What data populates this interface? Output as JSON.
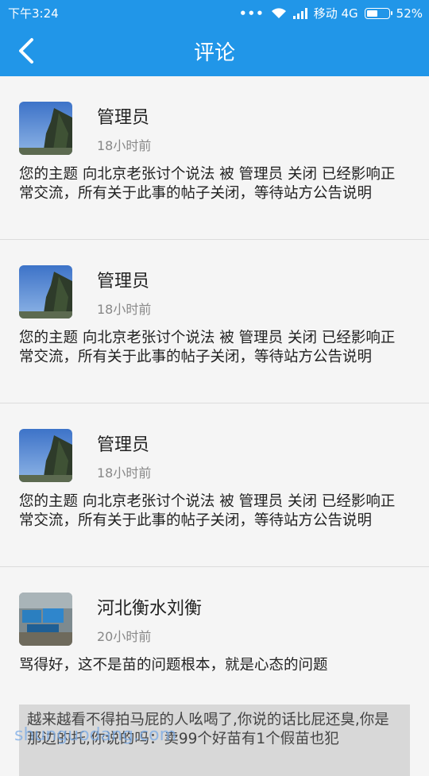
{
  "status": {
    "time": "下午3:24",
    "dots": "•••",
    "carrier": "移动 4G",
    "battery_percent": 52,
    "battery_text": "52%"
  },
  "header": {
    "title": "评论"
  },
  "comments": [
    {
      "name": "管理员",
      "time": "18小时前",
      "content": "您的主题 向北京老张讨个说法 被 管理员 关闭 已经影响正常交流，所有关于此事的帖子关闭，等待站方公告说明"
    },
    {
      "name": "管理员",
      "time": "18小时前",
      "content": "您的主题 向北京老张讨个说法 被 管理员 关闭 已经影响正常交流，所有关于此事的帖子关闭，等待站方公告说明"
    },
    {
      "name": "管理员",
      "time": "18小时前",
      "content": "您的主题 向北京老张讨个说法 被 管理员 关闭 已经影响正常交流，所有关于此事的帖子关闭，等待站方公告说明"
    },
    {
      "name": "河北衡水刘衡",
      "time": "20小时前",
      "content": "骂得好，这不是苗的问题根本，就是心态的问题"
    }
  ],
  "toast": {
    "text": "越来越看不得拍马屁的人吆喝了,你说的话比屁还臭,你是那边的托,你说的吗：卖99个好苗有1个假苗也犯"
  },
  "watermark": {
    "text": "shunguodang.com"
  }
}
